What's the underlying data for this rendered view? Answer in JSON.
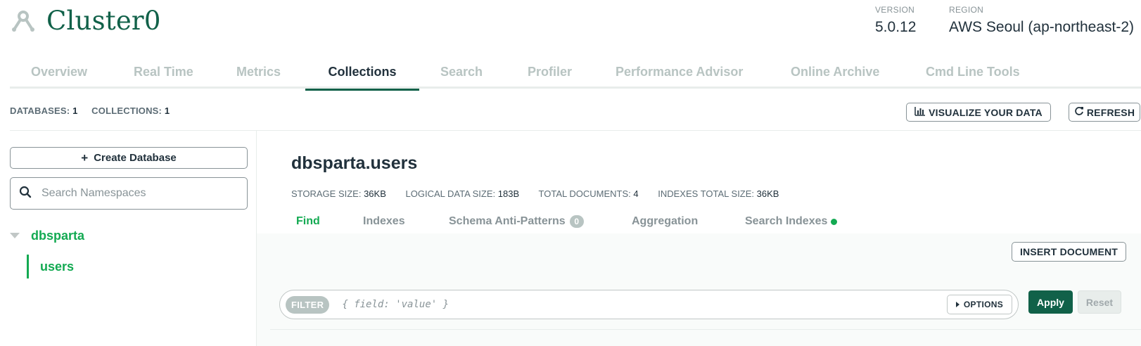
{
  "header": {
    "cluster_name": "Cluster0",
    "version_label": "VERSION",
    "version_value": "5.0.12",
    "region_label": "REGION",
    "region_value": "AWS Seoul (ap-northeast-2)"
  },
  "tabs": [
    {
      "label": "Overview",
      "active": false
    },
    {
      "label": "Real Time",
      "active": false
    },
    {
      "label": "Metrics",
      "active": false
    },
    {
      "label": "Collections",
      "active": true
    },
    {
      "label": "Search",
      "active": false
    },
    {
      "label": "Profiler",
      "active": false
    },
    {
      "label": "Performance Advisor",
      "active": false
    },
    {
      "label": "Online Archive",
      "active": false
    },
    {
      "label": "Cmd Line Tools",
      "active": false
    }
  ],
  "counts": {
    "databases_label": "DATABASES:",
    "databases_value": "1",
    "collections_label": "COLLECTIONS:",
    "collections_value": "1"
  },
  "toolbar": {
    "visualize_label": "VISUALIZE YOUR DATA",
    "refresh_label": "REFRESH"
  },
  "sidebar": {
    "create_db_label": "Create Database",
    "search_placeholder": "Search Namespaces",
    "database": "dbsparta",
    "collection": "users"
  },
  "main": {
    "namespace": "dbsparta.users",
    "stats": {
      "storage_label": "STORAGE SIZE:",
      "storage_value": "36KB",
      "logical_label": "LOGICAL DATA SIZE:",
      "logical_value": "183B",
      "docs_label": "TOTAL DOCUMENTS:",
      "docs_value": "4",
      "indexes_label": "INDEXES TOTAL SIZE:",
      "indexes_value": "36KB"
    },
    "sub_tabs": {
      "find": "Find",
      "indexes": "Indexes",
      "schema": "Schema Anti-Patterns",
      "schema_count": "0",
      "aggregation": "Aggregation",
      "search_indexes": "Search Indexes"
    },
    "insert_label": "INSERT DOCUMENT",
    "filter_label": "FILTER",
    "filter_placeholder": "{ field: 'value' }",
    "options_label": "OPTIONS",
    "apply_label": "Apply",
    "reset_label": "Reset"
  },
  "colors": {
    "brand_dark": "#116149",
    "brand_green": "#13aa52",
    "muted": "#889397"
  },
  "icons": [
    "cluster-icon",
    "bar-chart-icon",
    "refresh-icon",
    "plus-icon",
    "search-icon",
    "caret-down-icon",
    "caret-right-icon",
    "status-dot-icon"
  ]
}
